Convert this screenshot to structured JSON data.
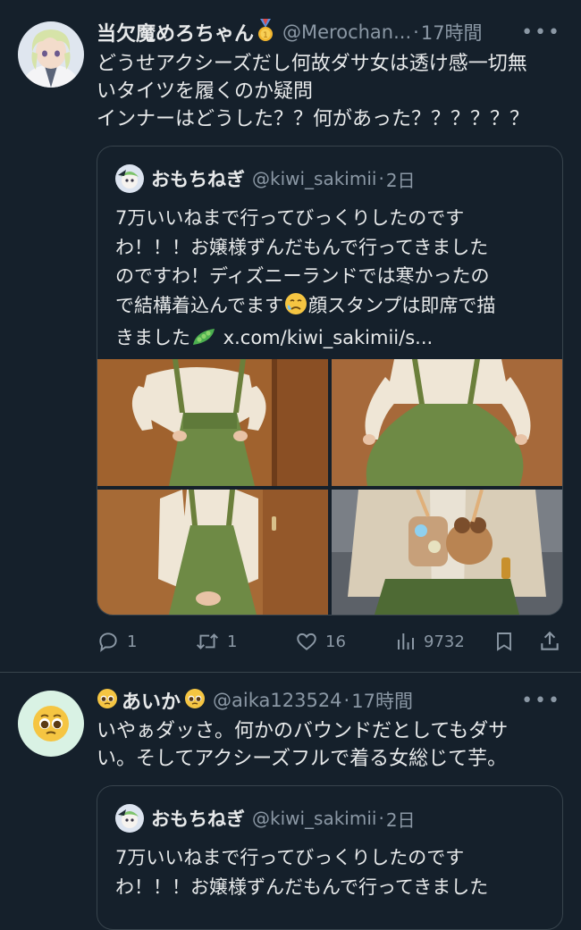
{
  "tweets": [
    {
      "name": "当欠魔めろちゃん",
      "handle": "@Merochan...",
      "time": "17時間",
      "text": "どうせアクシーズだし何故ダサ女は透け感一切無\nいタイツを履くのか疑問\nインナーはどうした？？何があった？？？？？？",
      "quote": {
        "name": "おもちねぎ",
        "handle": "@kiwi_sakimii",
        "time": "2日",
        "text_before_emoji": "7万いいねまで行ってびっくりしたのです\nわ！！！お嬢様ずんだもんで行ってきました\nのですわ！ディズニーランドでは寒かったの\nで結構着込んでます",
        "text_mid": "顔スタンプは即席で描\nきました",
        "link": " x.com/kiwi_sakimii/s..."
      },
      "stats": {
        "replies": "1",
        "retweets": "1",
        "likes": "16",
        "views": "9732"
      }
    },
    {
      "name": "あいか",
      "handle": "@aika123524",
      "time": "17時間",
      "text": "いやぁダッさ。何かのバウンドだとしてもダサ\nい。そしてアクシーズフルで着る女総じて芋。",
      "quote": {
        "name": "おもちねぎ",
        "handle": "@kiwi_sakimii",
        "time": "2日",
        "text": "7万いいねまで行ってびっくりしたのです\nわ！！！お嬢様ずんだもんで行ってきました"
      }
    }
  ],
  "ui": {
    "separator": "·",
    "more": "•••"
  },
  "icons": [
    "reply-icon",
    "retweet-icon",
    "like-icon",
    "views-icon",
    "bookmark-icon",
    "share-icon",
    "medal-emoji",
    "pleading-face-emoji",
    "sad-face-emoji",
    "pea-pod-emoji"
  ],
  "colors": {
    "background": "#15202b",
    "text": "#e7e9ea",
    "secondary": "#8b98a5",
    "border": "#38444d"
  }
}
